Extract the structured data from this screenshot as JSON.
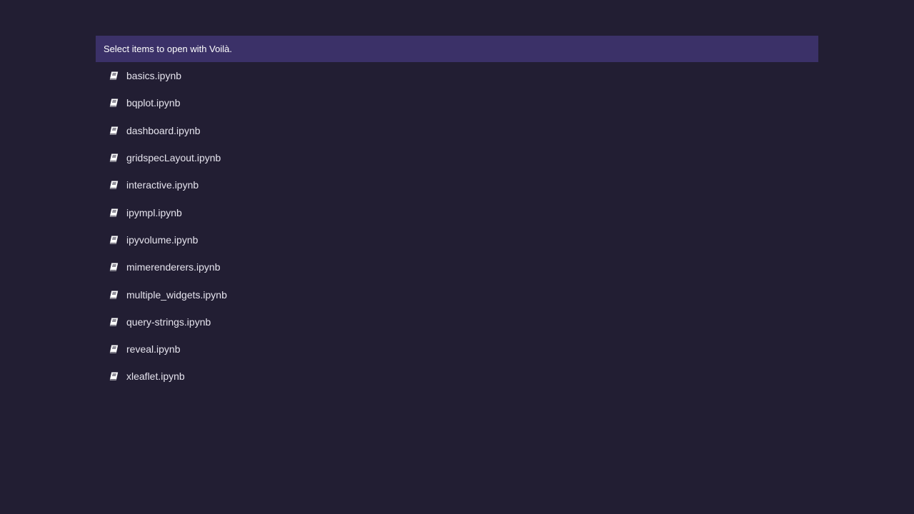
{
  "header": {
    "text": "Select items to open with Voilà."
  },
  "files": [
    {
      "name": "basics.ipynb",
      "icon": "notebook-icon"
    },
    {
      "name": "bqplot.ipynb",
      "icon": "notebook-icon"
    },
    {
      "name": "dashboard.ipynb",
      "icon": "notebook-icon"
    },
    {
      "name": "gridspecLayout.ipynb",
      "icon": "notebook-icon"
    },
    {
      "name": "interactive.ipynb",
      "icon": "notebook-icon"
    },
    {
      "name": "ipympl.ipynb",
      "icon": "notebook-icon"
    },
    {
      "name": "ipyvolume.ipynb",
      "icon": "notebook-icon"
    },
    {
      "name": "mimerenderers.ipynb",
      "icon": "notebook-icon"
    },
    {
      "name": "multiple_widgets.ipynb",
      "icon": "notebook-icon"
    },
    {
      "name": "query-strings.ipynb",
      "icon": "notebook-icon"
    },
    {
      "name": "reveal.ipynb",
      "icon": "notebook-icon"
    },
    {
      "name": "xleaflet.ipynb",
      "icon": "notebook-icon"
    }
  ],
  "colors": {
    "background": "#221e33",
    "header_bg": "#3b3168",
    "text": "#e6e4ee"
  }
}
